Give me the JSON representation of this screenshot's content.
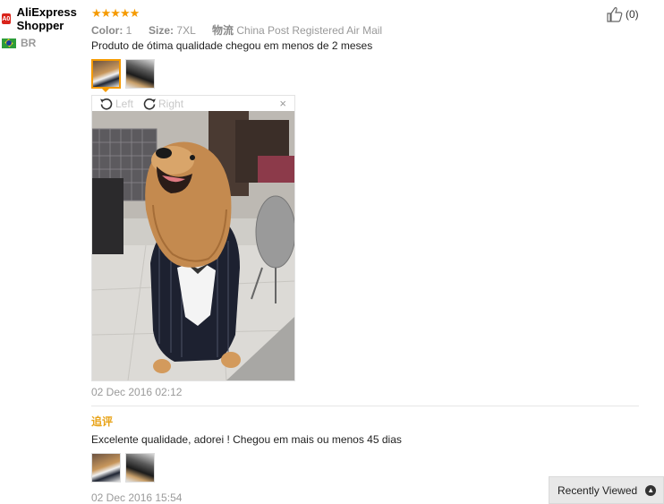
{
  "user": {
    "badge": "A0",
    "name": "AliExpress Shopper",
    "country": "BR"
  },
  "review": {
    "stars": "★★★★★",
    "color_label": "Color:",
    "color_value": "1",
    "size_label": "Size:",
    "size_value": "7XL",
    "shipping_label": "物流",
    "shipping_value": "China Post Registered Air Mail",
    "helpful_count": "(0)",
    "text": "Produto de ótima qualidade chegou em menos de 2 meses",
    "date": "02 Dec 2016 02:12"
  },
  "viewer": {
    "left_label": "Left",
    "right_label": "Right",
    "close": "×"
  },
  "followup": {
    "label": "追评",
    "text": "Excelente qualidade, adorei ! Chegou em mais ou menos 45 dias",
    "date": "02 Dec 2016 15:54"
  },
  "recently_viewed": {
    "label": "Recently Viewed",
    "icon": "chevron-up-icon"
  },
  "colors": {
    "star": "#f59a00",
    "append_label": "#e8a317",
    "badge": "#d9241b"
  }
}
